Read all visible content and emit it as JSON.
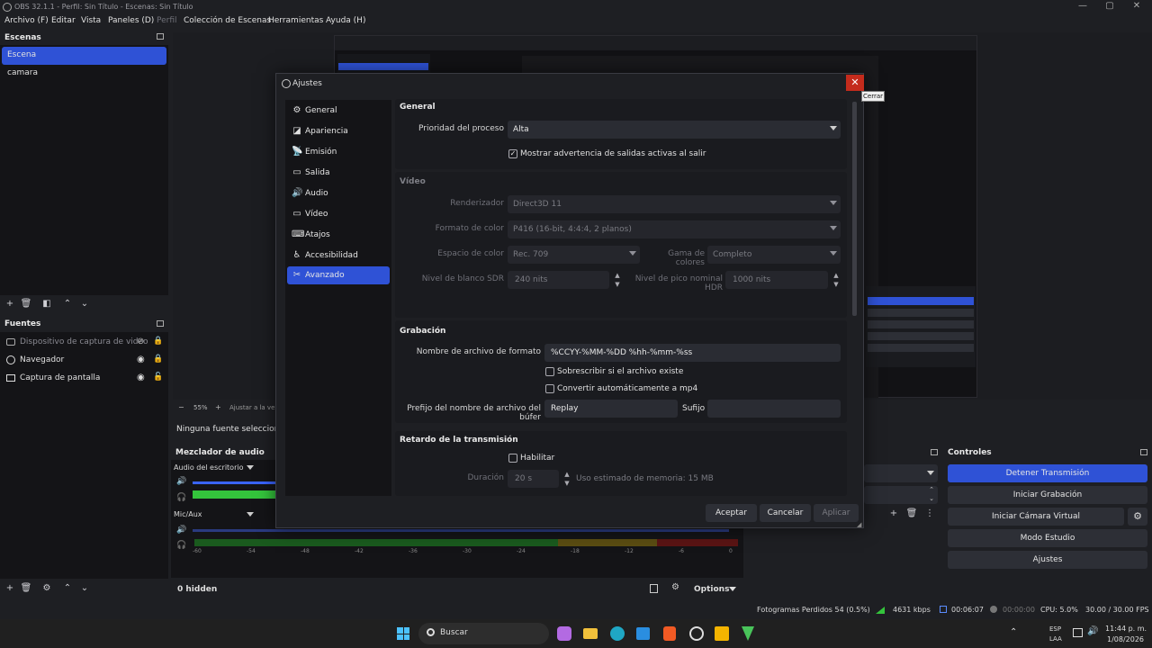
{
  "window": {
    "title": "OBS 32.1.1 - Perfil: Sin Título - Escenas: Sin Título"
  },
  "menu": [
    "Archivo (F)",
    "Editar",
    "Vista",
    "Paneles (D)",
    "Perfil",
    "Colección de Escenas",
    "Herramientas",
    "Ayuda (H)"
  ],
  "scenes": {
    "title": "Escenas",
    "items": [
      "Escena",
      "camara"
    ]
  },
  "sources": {
    "title": "Fuentes",
    "items": [
      "Dispositivo de captura de video",
      "Navegador",
      "Captura de pantalla"
    ]
  },
  "preview_bar": {
    "zoom": "55%",
    "fit": "Ajustar a la ventana"
  },
  "no_source": "Ninguna fuente seleccionada",
  "mixer": {
    "title": "Mezclador de audio",
    "channels": [
      "Audio del escritorio",
      "Mic/Aux"
    ],
    "ticks": [
      "-60",
      "-54",
      "-48",
      "-42",
      "-36",
      "-30",
      "-24",
      "-18",
      "-12",
      "-6",
      "0"
    ],
    "hidden": "0 hidden",
    "options": "Options"
  },
  "controls": {
    "title": "Controles",
    "buttons": [
      "Detener Transmisión",
      "Iniciar Grabación",
      "Iniciar Cámara Virtual",
      "Modo Estudio",
      "Ajustes"
    ]
  },
  "status": {
    "dropped": "Fotogramas Perdidos 54 (0.5%)",
    "bitrate": "4631 kbps",
    "stream_time": "00:06:07",
    "rec_time": "00:00:00",
    "cpu": "CPU: 5.0%",
    "fps": "30.00 / 30.00 FPS"
  },
  "taskbar": {
    "search": "Buscar",
    "lang1": "ESP",
    "lang2": "LAA",
    "time": "11:44 p. m.",
    "date": "1/08/2026"
  },
  "dialog": {
    "title": "Ajustes",
    "close_tooltip": "Cerrar",
    "nav": [
      "General",
      "Apariencia",
      "Emisión",
      "Salida",
      "Audio",
      "Vídeo",
      "Atajos",
      "Accesibilidad",
      "Avanzado"
    ],
    "general": {
      "title": "General",
      "priority_label": "Prioridad del proceso",
      "priority_value": "Alta",
      "warn_label": "Mostrar advertencia de salidas activas al salir"
    },
    "video": {
      "title": "Vídeo",
      "renderer_label": "Renderizador",
      "renderer_value": "Direct3D 11",
      "color_format_label": "Formato de color",
      "color_format_value": "P416 (16-bit, 4:4:4, 2 planos)",
      "color_space_label": "Espacio de color",
      "color_space_value": "Rec. 709",
      "color_range_label": "Gama de colores",
      "color_range_value": "Completo",
      "sdr_label": "Nivel de blanco SDR",
      "sdr_value": "240 nits",
      "hdr_label": "Nivel de pico nominal HDR",
      "hdr_value": "1000 nits"
    },
    "recording": {
      "title": "Grabación",
      "format_label": "Nombre de archivo de formato",
      "format_value": "%CCYY-%MM-%DD %hh-%mm-%ss",
      "overwrite_label": "Sobrescribir si el archivo existe",
      "remux_label": "Convertir automáticamente a mp4",
      "prefix_label": "Prefijo del nombre de archivo del búfer",
      "prefix_value": "Replay",
      "suffix_label": "Sufijo",
      "suffix_value": ""
    },
    "delay": {
      "title": "Retardo de la transmisión",
      "enable_label": "Habilitar",
      "duration_label": "Duración",
      "duration_value": "20 s",
      "memory_text": "Uso estimado de memoria: 15 MB"
    },
    "buttons": {
      "ok": "Aceptar",
      "cancel": "Cancelar",
      "apply": "Aplicar"
    }
  }
}
